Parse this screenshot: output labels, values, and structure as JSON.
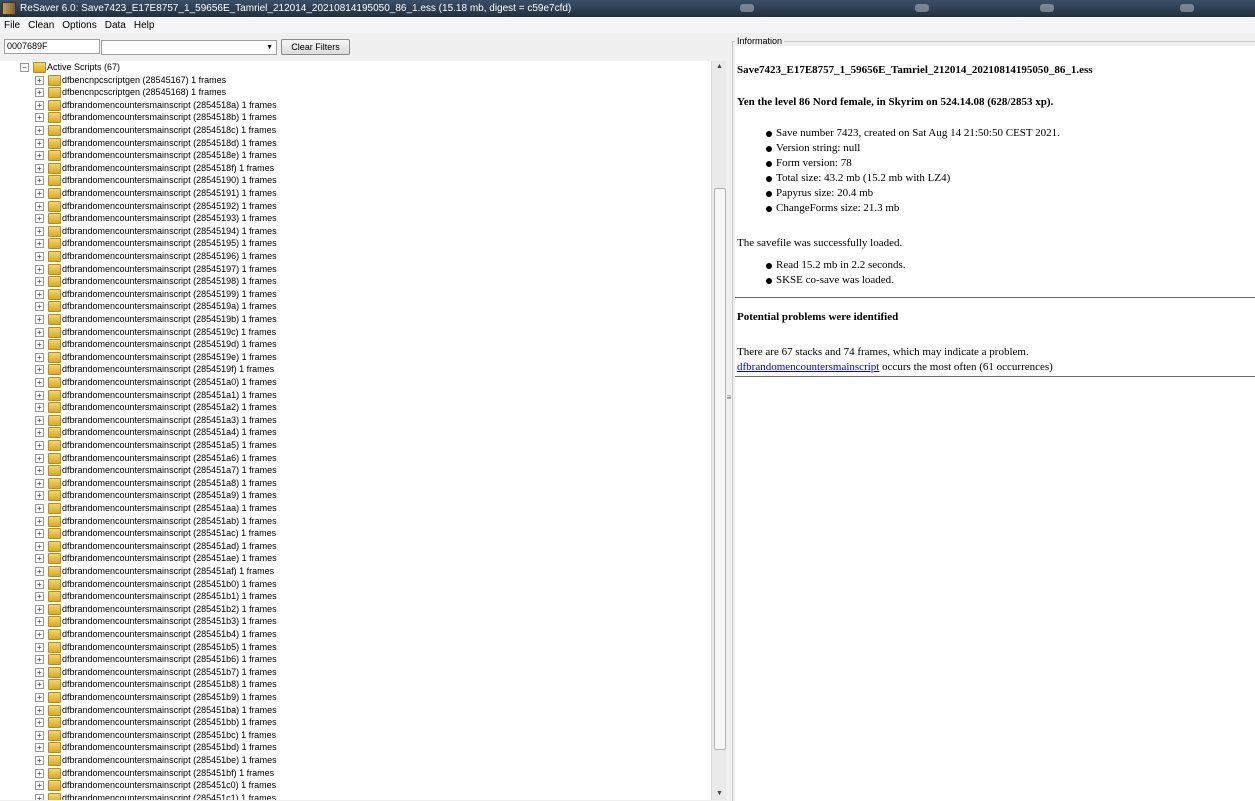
{
  "window": {
    "title": "ReSaver 6.0: Save7423_E17E8757_1_59656E_Tamriel_212014_20210814195050_86_1.ess (15.18 mb, digest = c59e7cfd)"
  },
  "menu": [
    "File",
    "Clean",
    "Options",
    "Data",
    "Help"
  ],
  "filter": {
    "value": "0007689F",
    "combo_value": "",
    "clear_label": "Clear Filters"
  },
  "tree": {
    "root": "Active Scripts (67)",
    "items": [
      "dfbencnpcscriptgen (28545167) 1 frames",
      "dfbencnpcscriptgen (28545168) 1 frames",
      "dfbrandomencountersmainscript (2854518a) 1 frames",
      "dfbrandomencountersmainscript (2854518b) 1 frames",
      "dfbrandomencountersmainscript (2854518c) 1 frames",
      "dfbrandomencountersmainscript (2854518d) 1 frames",
      "dfbrandomencountersmainscript (2854518e) 1 frames",
      "dfbrandomencountersmainscript (2854518f) 1 frames",
      "dfbrandomencountersmainscript (28545190) 1 frames",
      "dfbrandomencountersmainscript (28545191) 1 frames",
      "dfbrandomencountersmainscript (28545192) 1 frames",
      "dfbrandomencountersmainscript (28545193) 1 frames",
      "dfbrandomencountersmainscript (28545194) 1 frames",
      "dfbrandomencountersmainscript (28545195) 1 frames",
      "dfbrandomencountersmainscript (28545196) 1 frames",
      "dfbrandomencountersmainscript (28545197) 1 frames",
      "dfbrandomencountersmainscript (28545198) 1 frames",
      "dfbrandomencountersmainscript (28545199) 1 frames",
      "dfbrandomencountersmainscript (2854519a) 1 frames",
      "dfbrandomencountersmainscript (2854519b) 1 frames",
      "dfbrandomencountersmainscript (2854519c) 1 frames",
      "dfbrandomencountersmainscript (2854519d) 1 frames",
      "dfbrandomencountersmainscript (2854519e) 1 frames",
      "dfbrandomencountersmainscript (2854519f) 1 frames",
      "dfbrandomencountersmainscript (285451a0) 1 frames",
      "dfbrandomencountersmainscript (285451a1) 1 frames",
      "dfbrandomencountersmainscript (285451a2) 1 frames",
      "dfbrandomencountersmainscript (285451a3) 1 frames",
      "dfbrandomencountersmainscript (285451a4) 1 frames",
      "dfbrandomencountersmainscript (285451a5) 1 frames",
      "dfbrandomencountersmainscript (285451a6) 1 frames",
      "dfbrandomencountersmainscript (285451a7) 1 frames",
      "dfbrandomencountersmainscript (285451a8) 1 frames",
      "dfbrandomencountersmainscript (285451a9) 1 frames",
      "dfbrandomencountersmainscript (285451aa) 1 frames",
      "dfbrandomencountersmainscript (285451ab) 1 frames",
      "dfbrandomencountersmainscript (285451ac) 1 frames",
      "dfbrandomencountersmainscript (285451ad) 1 frames",
      "dfbrandomencountersmainscript (285451ae) 1 frames",
      "dfbrandomencountersmainscript (285451af) 1 frames",
      "dfbrandomencountersmainscript (285451b0) 1 frames",
      "dfbrandomencountersmainscript (285451b1) 1 frames",
      "dfbrandomencountersmainscript (285451b2) 1 frames",
      "dfbrandomencountersmainscript (285451b3) 1 frames",
      "dfbrandomencountersmainscript (285451b4) 1 frames",
      "dfbrandomencountersmainscript (285451b5) 1 frames",
      "dfbrandomencountersmainscript (285451b6) 1 frames",
      "dfbrandomencountersmainscript (285451b7) 1 frames",
      "dfbrandomencountersmainscript (285451b8) 1 frames",
      "dfbrandomencountersmainscript (285451b9) 1 frames",
      "dfbrandomencountersmainscript (285451ba) 1 frames",
      "dfbrandomencountersmainscript (285451bb) 1 frames",
      "dfbrandomencountersmainscript (285451bc) 1 frames",
      "dfbrandomencountersmainscript (285451bd) 1 frames",
      "dfbrandomencountersmainscript (285451be) 1 frames",
      "dfbrandomencountersmainscript (285451bf) 1 frames",
      "dfbrandomencountersmainscript (285451c0) 1 frames",
      "dfbrandomencountersmainscript (285451c1) 1 frames"
    ]
  },
  "info": {
    "legend": "Information",
    "filename": "Save7423_E17E8757_1_59656E_Tamriel_212014_20210814195050_86_1.ess",
    "character": "Yen the level 86 Nord female, in Skyrim on 524.14.08 (628/2853 xp).",
    "details": [
      "Save number 7423, created on Sat Aug 14 21:50:50 CEST 2021.",
      "Version string: null",
      "Form version: 78",
      "Total size: 43.2 mb (15.2 mb with LZ4)",
      "Papyrus size: 20.4 mb",
      "ChangeForms size: 21.3 mb"
    ],
    "loaded": "The savefile was successfully loaded.",
    "load_details": [
      "Read 15.2 mb in 2.2 seconds.",
      "SKSE co-save was loaded."
    ],
    "problems_heading": "Potential problems were identified",
    "problem_text": "There are 67 stacks and 74 frames, which may indicate a problem.",
    "problem_link": "dfbrandomencountersmainscript",
    "problem_suffix": " occurs the most often (61 occurrences)"
  }
}
